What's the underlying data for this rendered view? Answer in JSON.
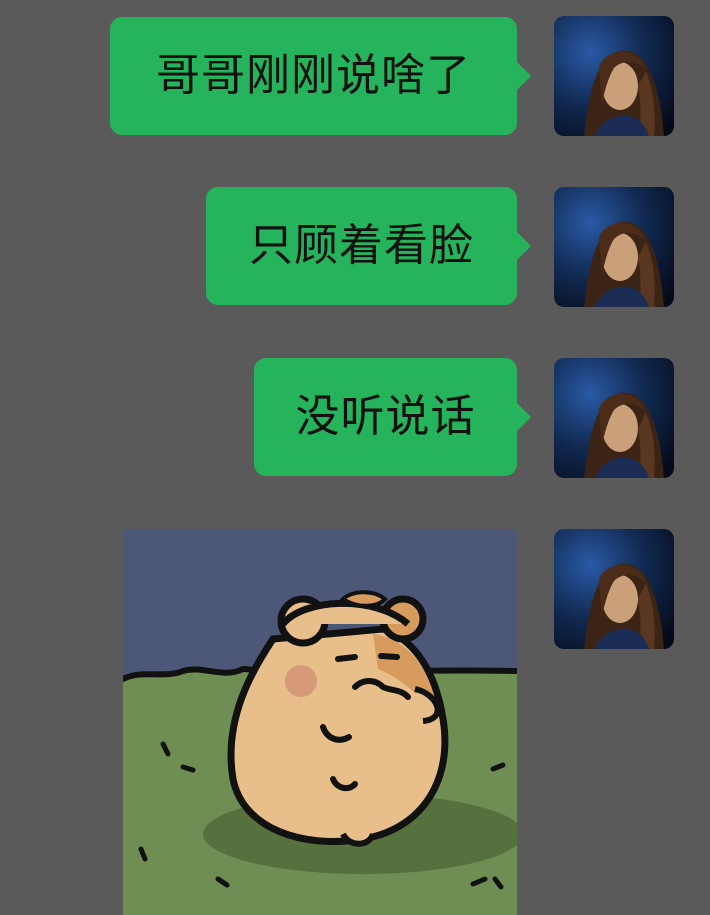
{
  "messages": [
    {
      "side": "sent",
      "type": "text",
      "text": "哥哥刚刚说啥了"
    },
    {
      "side": "sent",
      "type": "text",
      "text": "只顾着看脸"
    },
    {
      "side": "sent",
      "type": "text",
      "text": "没听说话"
    },
    {
      "side": "sent",
      "type": "sticker",
      "sticker": "bear-hamster-sticker"
    }
  ],
  "colors": {
    "background": "#5a5a5a",
    "bubble": "#25b35c",
    "text": "#111111"
  },
  "icons": {
    "avatar": "woman-portrait-avatar"
  }
}
